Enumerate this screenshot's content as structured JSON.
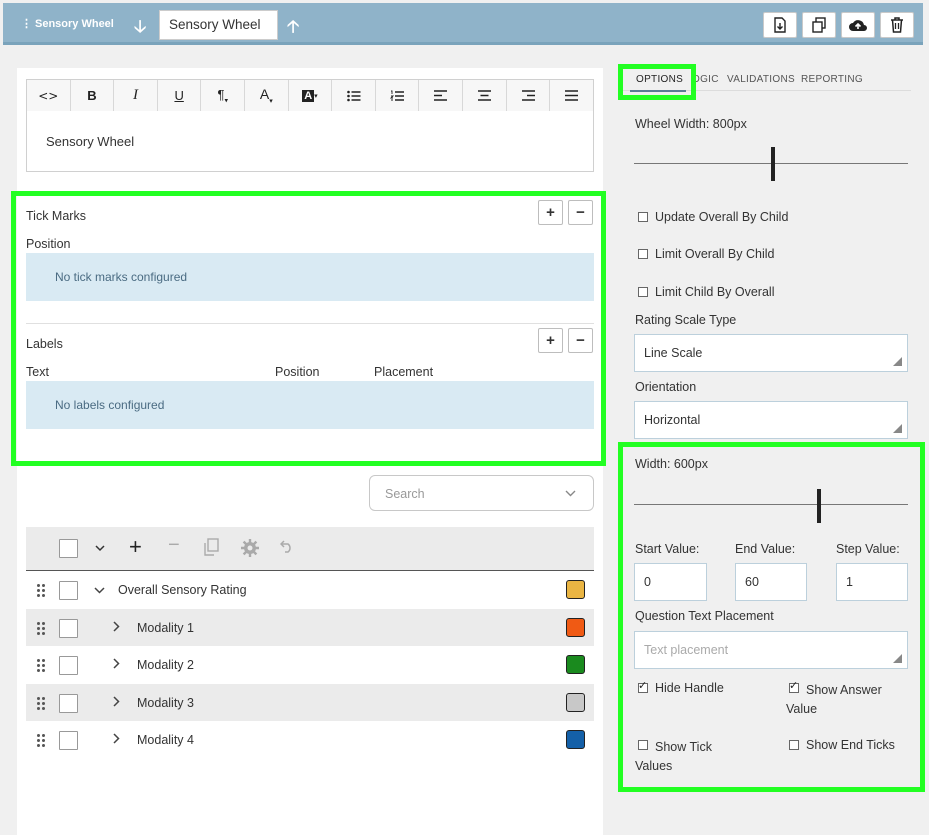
{
  "topbar": {
    "menu_label": "Sensory Wheel",
    "name_value": "Sensory Wheel",
    "icons": [
      "down-arrow-icon",
      "up-arrow-icon",
      "export-icon",
      "copy-icon",
      "upload-icon",
      "trash-icon"
    ]
  },
  "editor": {
    "toolbar": [
      "<>",
      "B",
      "I",
      "U",
      "¶",
      "A",
      "A",
      "bullet-list-icon",
      "numbered-list-icon",
      "align-left-icon",
      "align-center-icon",
      "align-right-icon",
      "justify-icon"
    ],
    "content": "Sensory Wheel"
  },
  "tick_marks": {
    "title": "Tick Marks",
    "col_position": "Position",
    "empty": "No tick marks configured"
  },
  "labels": {
    "title": "Labels",
    "col_text": "Text",
    "col_position": "Position",
    "col_placement": "Placement",
    "empty": "No labels configured"
  },
  "search": {
    "placeholder": "Search"
  },
  "tree": {
    "rows": [
      {
        "label": "Overall Sensory Rating",
        "color": "#eab543",
        "expanded": true
      },
      {
        "label": "Modality 1",
        "color": "#f05a14",
        "expanded": false
      },
      {
        "label": "Modality 2",
        "color": "#1a8a1e",
        "expanded": false
      },
      {
        "label": "Modality 3",
        "color": "#c8c8c8",
        "expanded": false
      },
      {
        "label": "Modality 4",
        "color": "#1460a8",
        "expanded": false
      }
    ]
  },
  "tabs": {
    "options": "OPTIONS",
    "logic": "LOGIC",
    "logic_visible": "OGIC",
    "validations": "VALIDATIONS",
    "reporting": "REPORTING",
    "active": "OPTIONS"
  },
  "options": {
    "wheel_width_label": "Wheel Width: 800px",
    "wheel_width_value": 800,
    "update_overall": "Update Overall By Child",
    "limit_overall": "Limit Overall By Child",
    "limit_child": "Limit Child By Overall",
    "rating_scale_type_label": "Rating Scale Type",
    "rating_scale_type_value": "Line Scale",
    "orientation_label": "Orientation",
    "orientation_value": "Horizontal",
    "width_label": "Width: 600px",
    "width_value": 600,
    "start_label": "Start Value:",
    "start_value": "0",
    "end_label": "End Value:",
    "end_value": "60",
    "step_label": "Step Value:",
    "step_value": "1",
    "question_text_placement_label": "Question Text Placement",
    "question_text_placement_placeholder": "Text placement",
    "hide_handle": "Hide Handle",
    "show_answer_value": "Show Answer Value",
    "show_tick_values": "Show Tick Values",
    "show_end_ticks": "Show End Ticks"
  }
}
